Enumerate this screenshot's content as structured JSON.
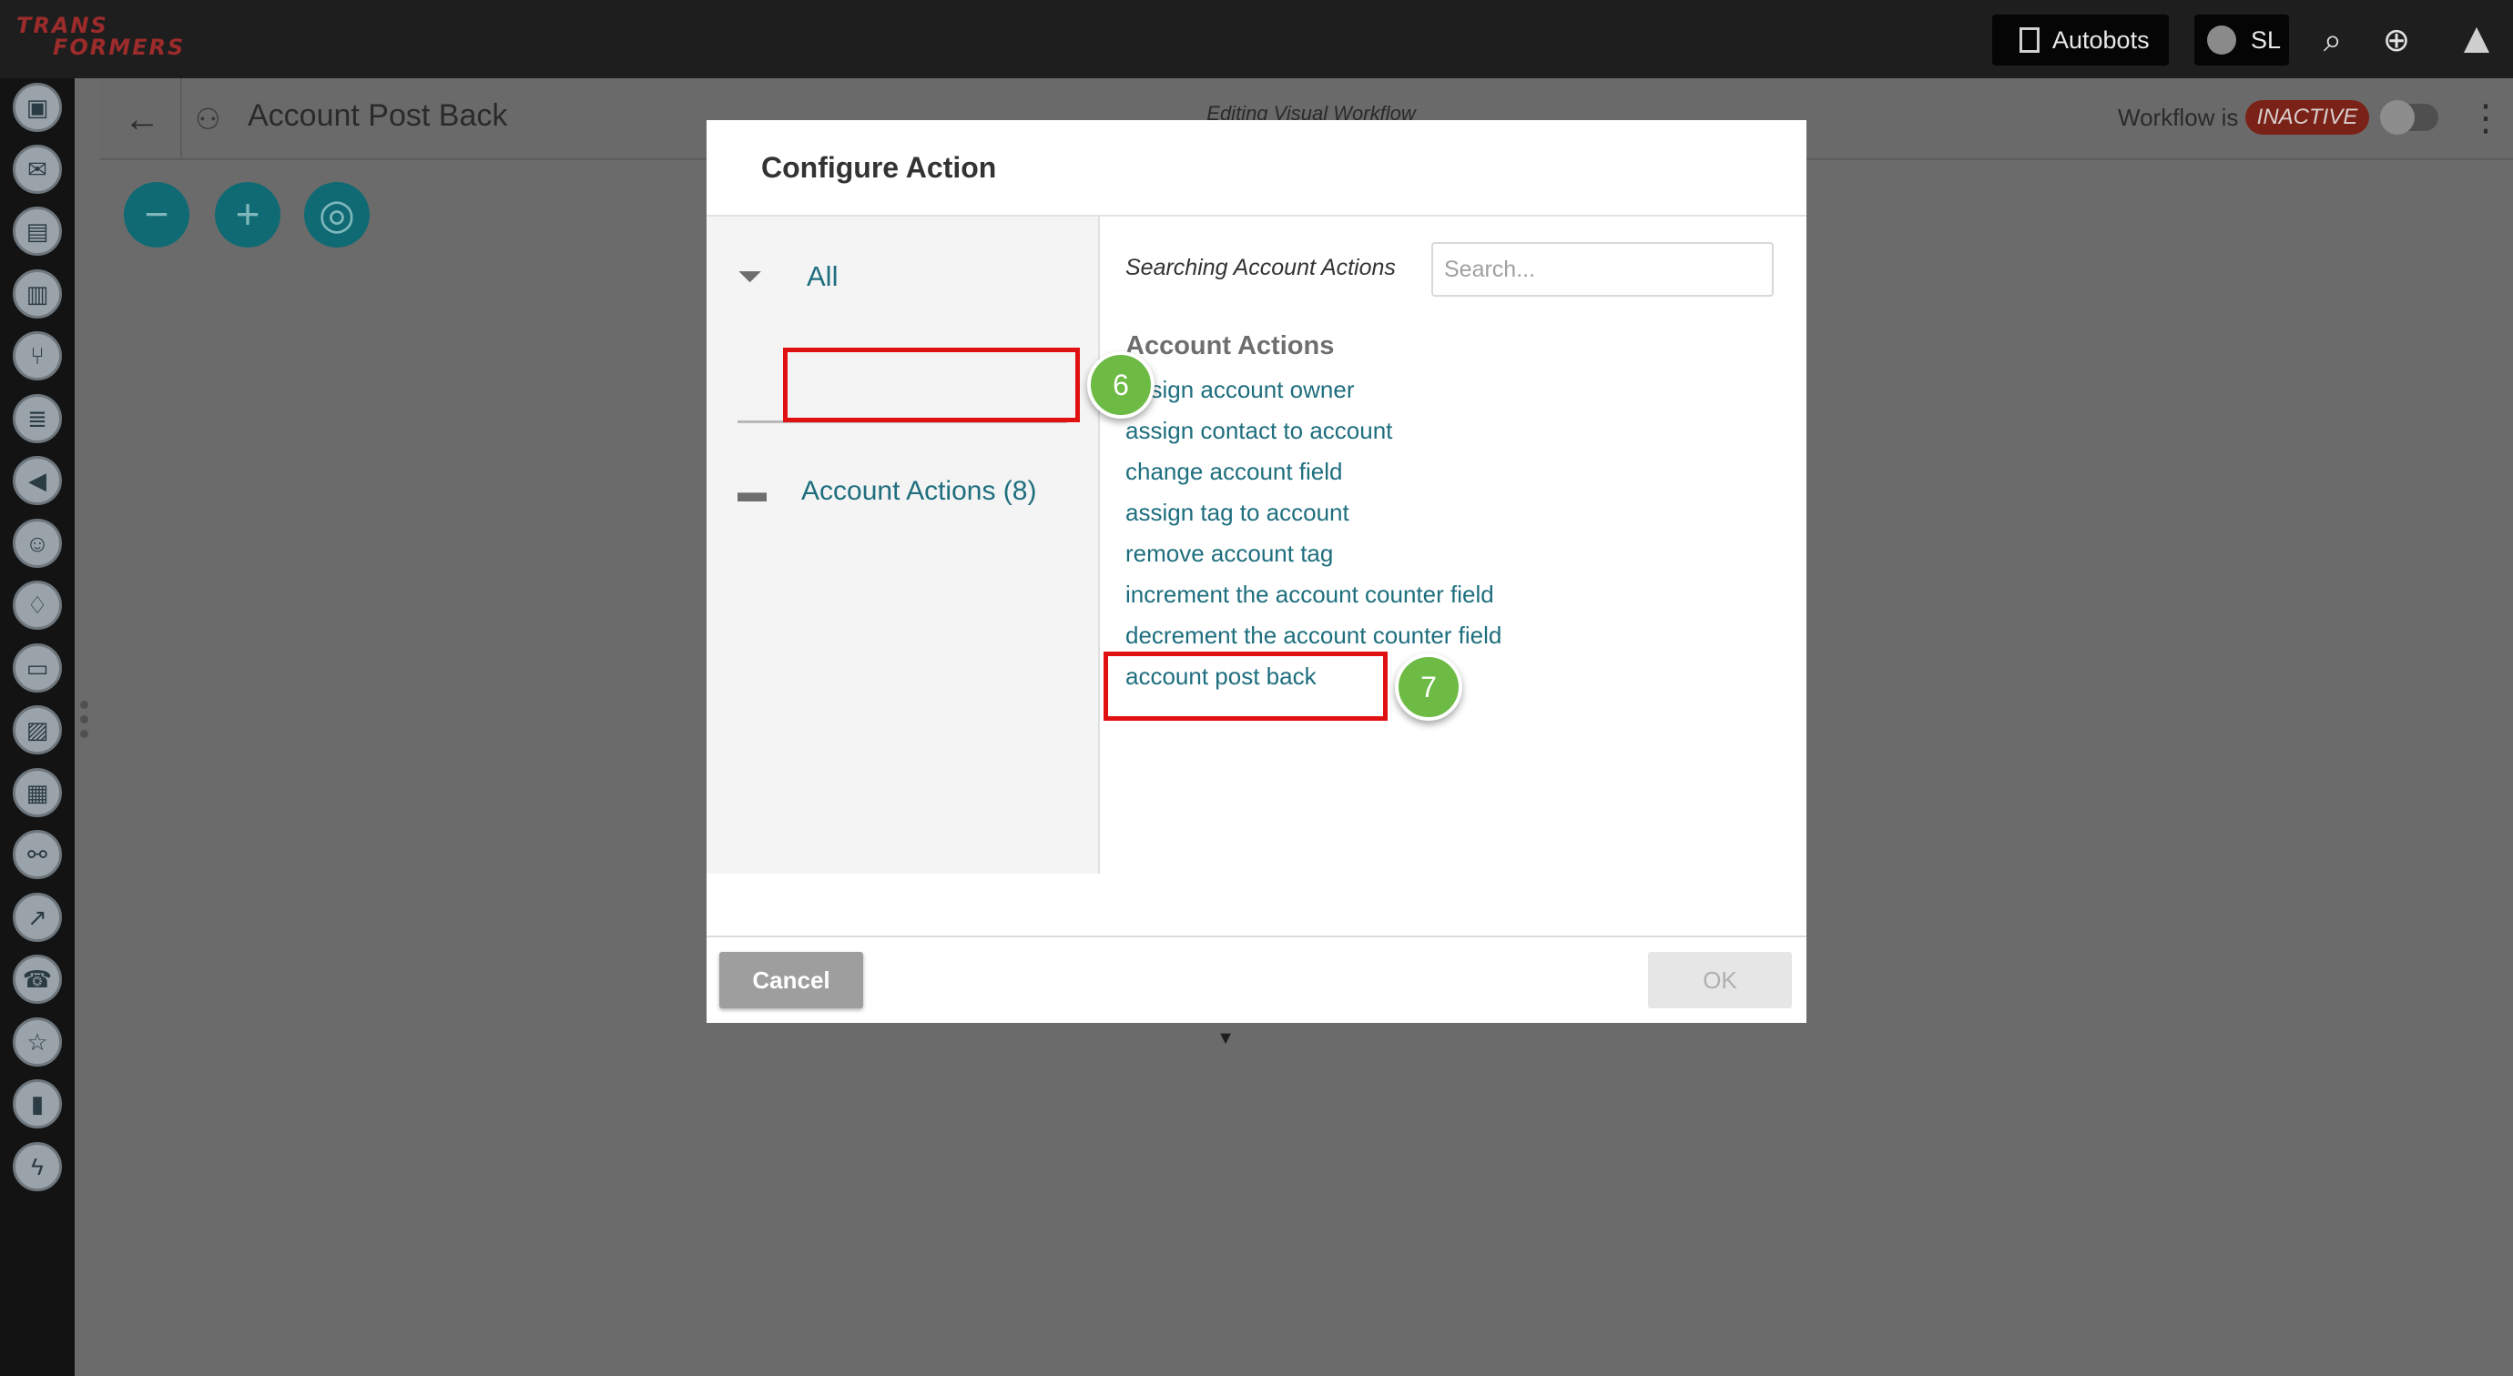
{
  "app": {
    "logo_line1": "TRANS",
    "logo_line2": "FORMERS"
  },
  "topbar": {
    "workspace": "Autobots",
    "user_initials": "SL"
  },
  "header": {
    "title": "Account Post Back",
    "caption": "Editing Visual Workflow",
    "workflow_label": "Workflow is",
    "workflow_status": "INACTIVE"
  },
  "canvas": {
    "zoom_out": "−",
    "zoom_in": "+",
    "center": "◎"
  },
  "modal": {
    "title": "Configure Action",
    "filter_all": "All",
    "category": "Account Actions (8)",
    "search_label": "Searching Account Actions",
    "search_placeholder": "Search...",
    "section_title": "Account Actions",
    "actions": [
      "assign account owner",
      "assign contact to account",
      "change account field",
      "assign tag to account",
      "remove account tag",
      "increment the account counter field",
      "decrement the account counter field",
      "account post back"
    ],
    "cancel": "Cancel",
    "ok": "OK"
  },
  "annotations": {
    "step_6": "6",
    "step_7": "7"
  },
  "colors": {
    "accent": "#1e6e7e",
    "highlight": "#e01111",
    "step": "#6dbb45",
    "status": "#c0392b"
  }
}
